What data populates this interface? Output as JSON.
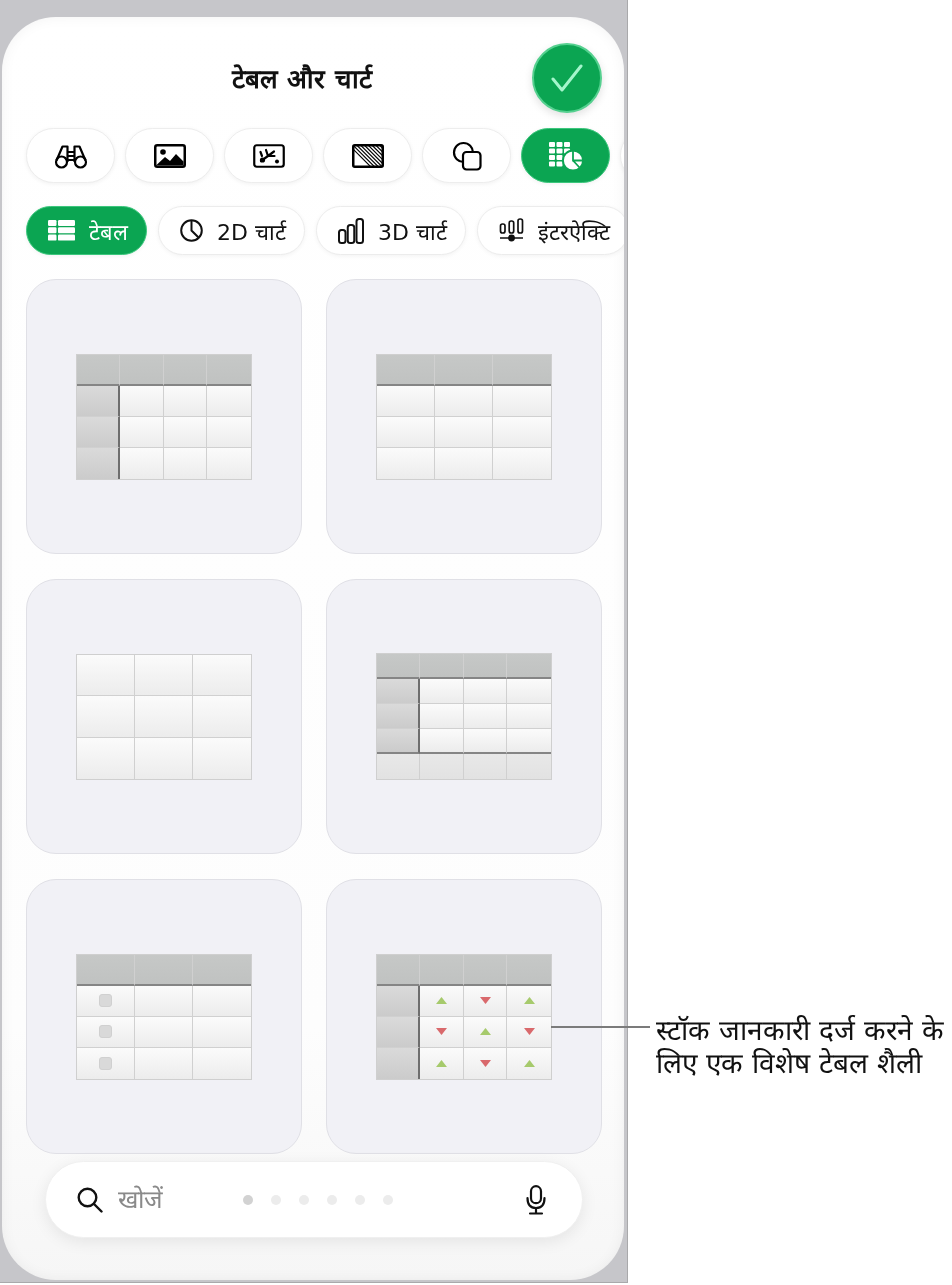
{
  "title": "टेबल और चार्ट",
  "insert_tabs": [
    {
      "selected": false
    },
    {
      "selected": false
    },
    {
      "selected": false
    },
    {
      "selected": false
    },
    {
      "selected": false
    },
    {
      "selected": true
    },
    {
      "selected": false
    }
  ],
  "categories": [
    {
      "label": "टेबल",
      "selected": true
    },
    {
      "label": "2D चार्ट",
      "selected": false
    },
    {
      "label": "3D चार्ट",
      "selected": false
    },
    {
      "label": "इंटरऐक्टि",
      "selected": false
    }
  ],
  "table_styles": [
    {
      "kind": "header-row-and-column"
    },
    {
      "kind": "header-row"
    },
    {
      "kind": "plain"
    },
    {
      "kind": "header-column-footer"
    },
    {
      "kind": "checklist"
    },
    {
      "kind": "stock"
    }
  ],
  "callout": {
    "text": "स्टॉक जानकारी दर्ज करने के लिए एक विशेष टेबल शैली"
  },
  "search": {
    "placeholder": "खोजें"
  },
  "page_dots": [
    {
      "selected": true
    },
    {
      "selected": false
    },
    {
      "selected": false
    },
    {
      "selected": false
    },
    {
      "selected": false
    },
    {
      "selected": false
    }
  ]
}
